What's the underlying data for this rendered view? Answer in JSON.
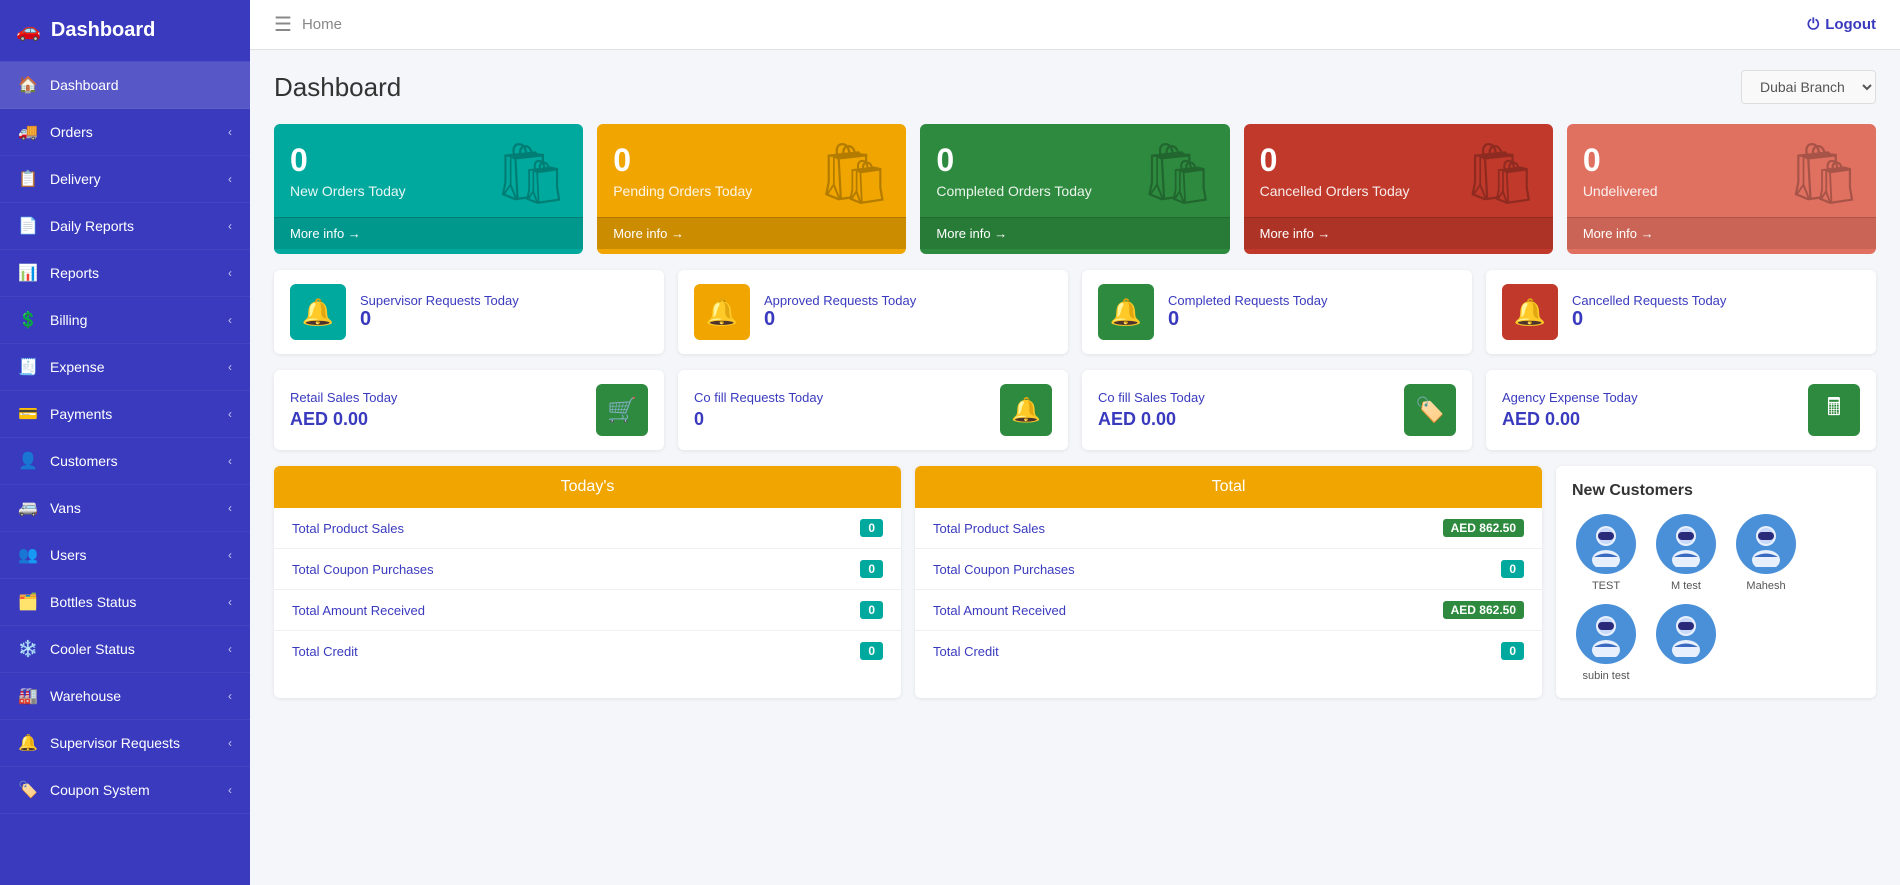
{
  "sidebar": {
    "logo": {
      "icon": "🚗",
      "label": "Dashboard"
    },
    "items": [
      {
        "id": "dashboard",
        "icon": "🏠",
        "label": "Dashboard",
        "active": true,
        "has_arrow": false
      },
      {
        "id": "orders",
        "icon": "🚚",
        "label": "Orders",
        "has_arrow": true
      },
      {
        "id": "delivery",
        "icon": "📋",
        "label": "Delivery",
        "has_arrow": true
      },
      {
        "id": "daily-reports",
        "icon": "📄",
        "label": "Daily Reports",
        "has_arrow": true
      },
      {
        "id": "reports",
        "icon": "📊",
        "label": "Reports",
        "has_arrow": true
      },
      {
        "id": "billing",
        "icon": "💲",
        "label": "Billing",
        "has_arrow": true
      },
      {
        "id": "expense",
        "icon": "🧾",
        "label": "Expense",
        "has_arrow": true
      },
      {
        "id": "payments",
        "icon": "💳",
        "label": "Payments",
        "has_arrow": true
      },
      {
        "id": "customers",
        "icon": "👤",
        "label": "Customers",
        "has_arrow": true
      },
      {
        "id": "vans",
        "icon": "🚐",
        "label": "Vans",
        "has_arrow": true
      },
      {
        "id": "users",
        "icon": "👥",
        "label": "Users",
        "has_arrow": true
      },
      {
        "id": "bottles-status",
        "icon": "🗂️",
        "label": "Bottles Status",
        "has_arrow": true
      },
      {
        "id": "cooler-status",
        "icon": "❄️",
        "label": "Cooler Status",
        "has_arrow": true
      },
      {
        "id": "warehouse",
        "icon": "🏭",
        "label": "Warehouse",
        "has_arrow": true
      },
      {
        "id": "supervisor-requests",
        "icon": "🔔",
        "label": "Supervisor Requests",
        "has_arrow": true
      },
      {
        "id": "coupon-system",
        "icon": "🏷️",
        "label": "Coupon System",
        "has_arrow": true
      }
    ]
  },
  "topbar": {
    "menu_icon": "☰",
    "breadcrumb": "Home",
    "logout_label": "Logout",
    "logout_icon": "⏻"
  },
  "page": {
    "title": "Dashboard",
    "branch": "Dubai Branch"
  },
  "stat_cards": [
    {
      "id": "new-orders",
      "color": "teal",
      "number": "0",
      "label": "New Orders Today",
      "footer": "More info →"
    },
    {
      "id": "pending-orders",
      "color": "yellow",
      "number": "0",
      "label": "Pending Orders Today",
      "footer": "More info →"
    },
    {
      "id": "completed-orders",
      "color": "green",
      "number": "0",
      "label": "Completed Orders Today",
      "footer": "More info →"
    },
    {
      "id": "cancelled-orders",
      "color": "red",
      "number": "0",
      "label": "Cancelled Orders Today",
      "footer": "More info →"
    },
    {
      "id": "undelivered",
      "color": "salmon",
      "number": "0",
      "label": "Undelivered",
      "footer": "More info →"
    }
  ],
  "request_cards": [
    {
      "id": "supervisor-requests",
      "color": "teal",
      "label": "Supervisor Requests Today",
      "value": "0"
    },
    {
      "id": "approved-requests",
      "color": "yellow",
      "label": "Approved Requests Today",
      "value": "0"
    },
    {
      "id": "completed-requests",
      "color": "green",
      "label": "Completed Requests Today",
      "value": "0"
    },
    {
      "id": "cancelled-requests",
      "color": "red",
      "label": "Cancelled Requests Today",
      "value": "0"
    }
  ],
  "sales_cards": [
    {
      "id": "retail-sales",
      "label": "Retail Sales Today",
      "value": "AED 0.00",
      "icon": "🛒"
    },
    {
      "id": "cofill-requests",
      "label": "Co fill Requests Today",
      "value": "0",
      "icon": "🔔"
    },
    {
      "id": "cofill-sales",
      "label": "Co fill Sales Today",
      "value": "AED 0.00",
      "icon": "🏷️"
    },
    {
      "id": "agency-expense",
      "label": "Agency Expense Today",
      "value": "AED 0.00",
      "icon": "🖩"
    }
  ],
  "todays_table": {
    "header": "Today's",
    "rows": [
      {
        "label": "Total Product Sales",
        "value": "0",
        "badge_type": "teal"
      },
      {
        "label": "Total Coupon Purchases",
        "value": "0",
        "badge_type": "teal"
      },
      {
        "label": "Total Amount Received",
        "value": "0",
        "badge_type": "teal"
      },
      {
        "label": "Total Credit",
        "value": "0",
        "badge_type": "teal"
      }
    ]
  },
  "total_table": {
    "header": "Total",
    "rows": [
      {
        "label": "Total Product Sales",
        "value": "AED 862.50",
        "badge_type": "amount"
      },
      {
        "label": "Total Coupon Purchases",
        "value": "0",
        "badge_type": "teal"
      },
      {
        "label": "Total Amount Received",
        "value": "AED 862.50",
        "badge_type": "amount"
      },
      {
        "label": "Total Credit",
        "value": "0",
        "badge_type": "teal"
      }
    ]
  },
  "new_customers": {
    "title": "New Customers",
    "items": [
      {
        "name": "TEST"
      },
      {
        "name": "M test"
      },
      {
        "name": "Mahesh"
      },
      {
        "name": "subin test"
      },
      {
        "name": ""
      }
    ]
  }
}
